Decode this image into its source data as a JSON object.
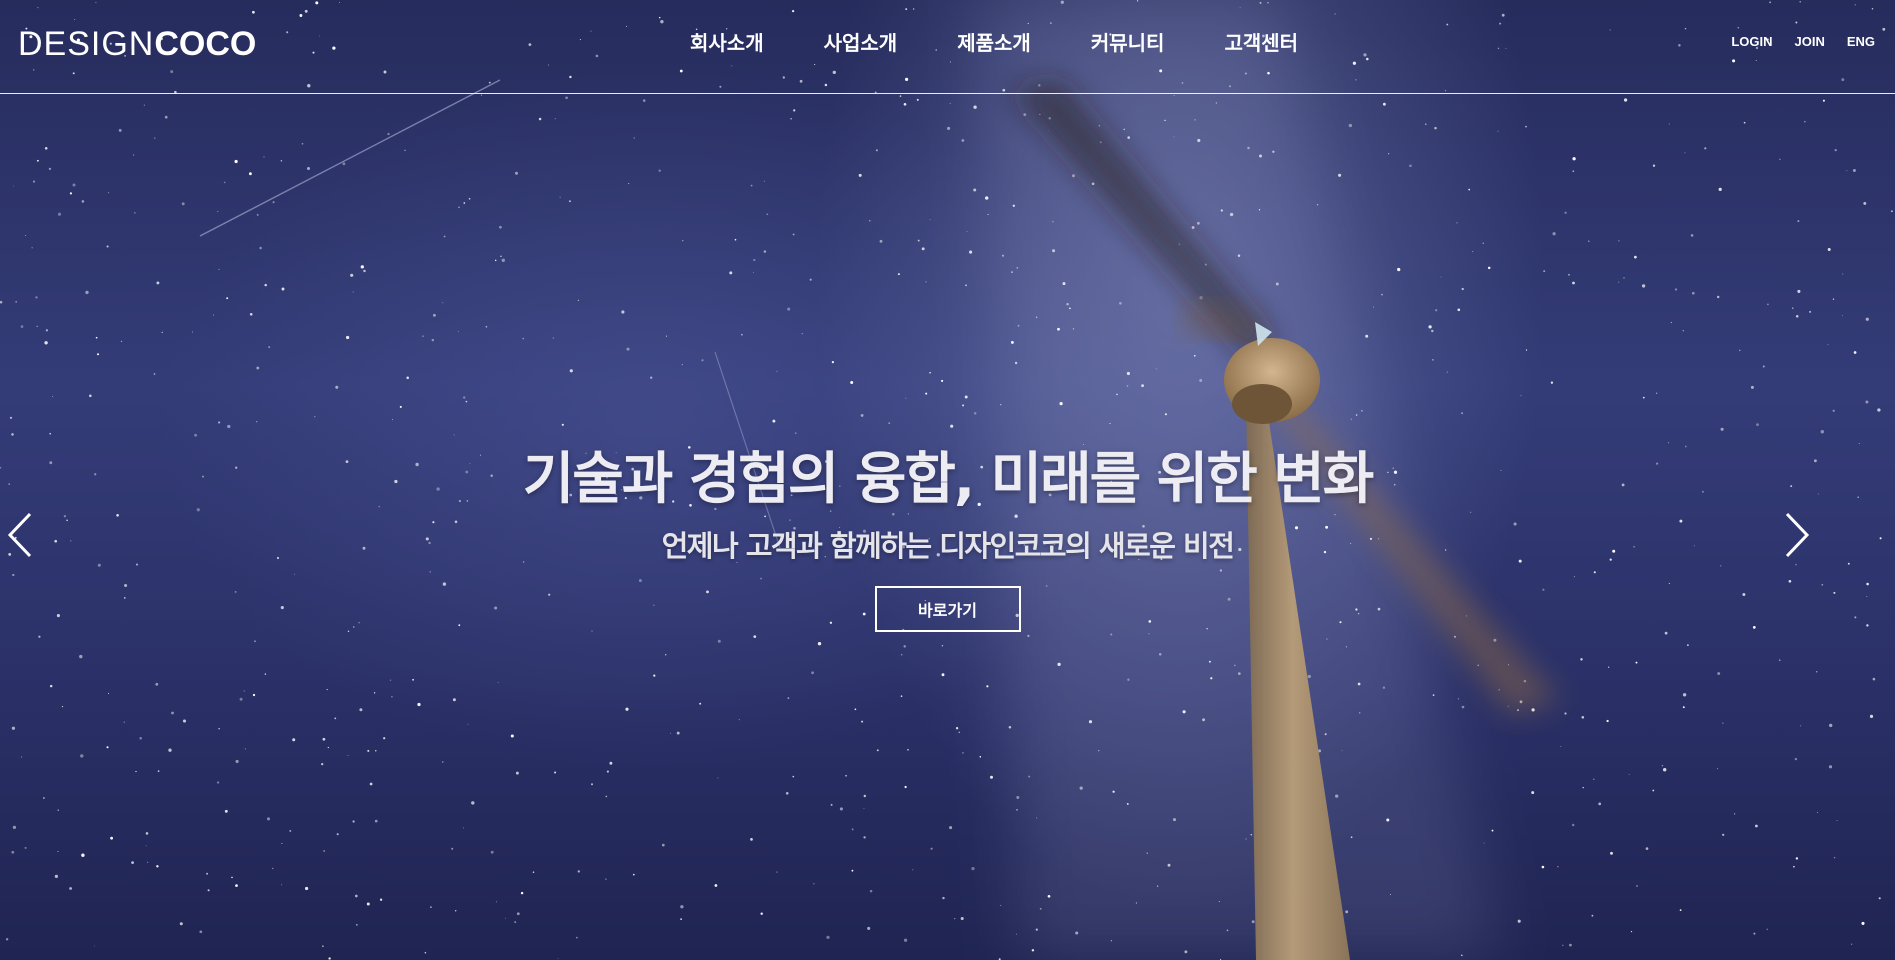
{
  "header": {
    "logo": {
      "light": "DESIGN",
      "bold": "COCO"
    },
    "nav": [
      "회사소개",
      "사업소개",
      "제품소개",
      "커뮤니티",
      "고객센터"
    ],
    "util": [
      "LOGIN",
      "JOIN",
      "ENG"
    ]
  },
  "hero": {
    "title": "기술과 경험의 융합, 미래를 위한 변화",
    "subtitle": "언제나 고객과 함께하는 디자인코코의 새로운 비전",
    "button": "바로가기"
  },
  "slider": {
    "prev_icon": "chevron-left-icon",
    "next_icon": "chevron-right-icon"
  },
  "colors": {
    "sky_top": "#262c5c",
    "sky_mid": "#343c78",
    "turbine": "#a88d6a",
    "text": "#ffffff"
  }
}
